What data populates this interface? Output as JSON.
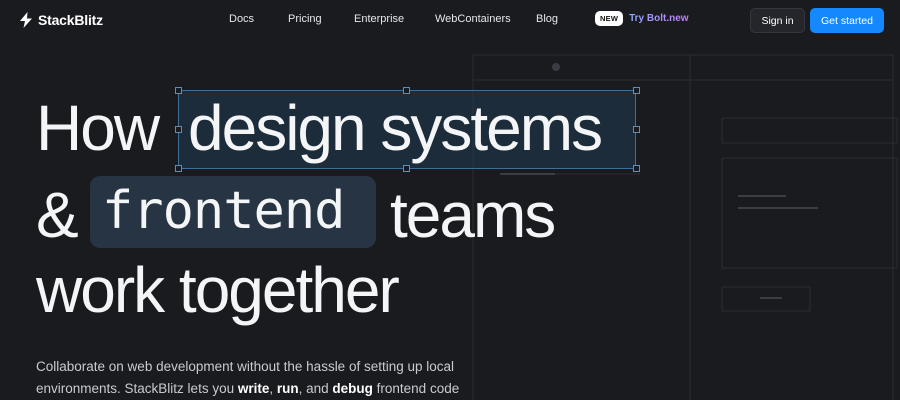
{
  "brand": {
    "name": "StackBlitz"
  },
  "nav": {
    "links": [
      {
        "label": "Docs"
      },
      {
        "label": "Pricing"
      },
      {
        "label": "Enterprise"
      },
      {
        "label": "WebContainers"
      },
      {
        "label": "Blog"
      }
    ],
    "badge": "NEW",
    "bolt_label": "Try Bolt.new",
    "signin_label": "Sign in",
    "get_started_label": "Get started"
  },
  "hero": {
    "line1_prefix": "How",
    "line1_highlight": "design systems",
    "line2_prefix": "&",
    "line2_highlight": "frontend",
    "line2_suffix": "teams",
    "line3": "work together"
  },
  "description": {
    "part1": "Collaborate on web development without the hassle of setting up local environments. StackBlitz lets you ",
    "write": "write",
    "sep1": ", ",
    "run": "run",
    "sep2": ", and ",
    "debug": "debug",
    "part2": " frontend code"
  },
  "colors": {
    "background": "#1a1b1f",
    "primary": "#1389fd",
    "highlight_border": "#3f6f95"
  }
}
